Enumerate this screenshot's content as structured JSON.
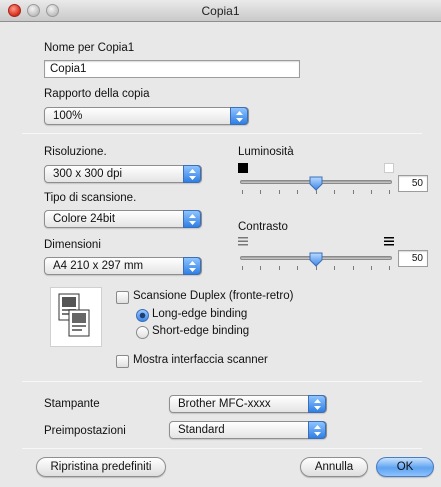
{
  "window": {
    "title": "Copia1"
  },
  "name_section": {
    "label": "Nome per Copia1",
    "value": "Copia1"
  },
  "ratio_section": {
    "label": "Rapporto della copia",
    "value": "100%"
  },
  "resolution": {
    "label": "Risoluzione.",
    "value": "300 x 300 dpi"
  },
  "scan_type": {
    "label": "Tipo di scansione.",
    "value": "Colore 24bit"
  },
  "dimensions": {
    "label": "Dimensioni",
    "value": "A4  210 x 297 mm"
  },
  "brightness": {
    "label": "Luminosità",
    "value": "50",
    "level_fraction": 0.5
  },
  "contrast": {
    "label": "Contrasto",
    "value": "50",
    "level_fraction": 0.5
  },
  "duplex": {
    "checkbox_label": "Scansione Duplex (fronte-retro)",
    "checked": false,
    "options": [
      "Long-edge binding",
      "Short-edge binding"
    ],
    "selected": "Long-edge binding"
  },
  "show_scanner_ui": {
    "label": "Mostra interfaccia scanner",
    "checked": false
  },
  "printer": {
    "label": "Stampante",
    "value": "Brother MFC-xxxx"
  },
  "presets": {
    "label": "Preimpostazioni",
    "value": "Standard"
  },
  "buttons": {
    "restore": "Ripristina predefiniti",
    "cancel": "Annulla",
    "ok": "OK"
  },
  "icons": [
    "close-icon",
    "minimize-icon",
    "zoom-icon",
    "popup-arrows-icon",
    "brightness-dark-icon",
    "brightness-light-icon",
    "contrast-low-icon",
    "contrast-high-icon",
    "duplex-preview-icon"
  ],
  "colors": {
    "accent": "#3d86e8",
    "window_bg": "#e8e8e8"
  }
}
